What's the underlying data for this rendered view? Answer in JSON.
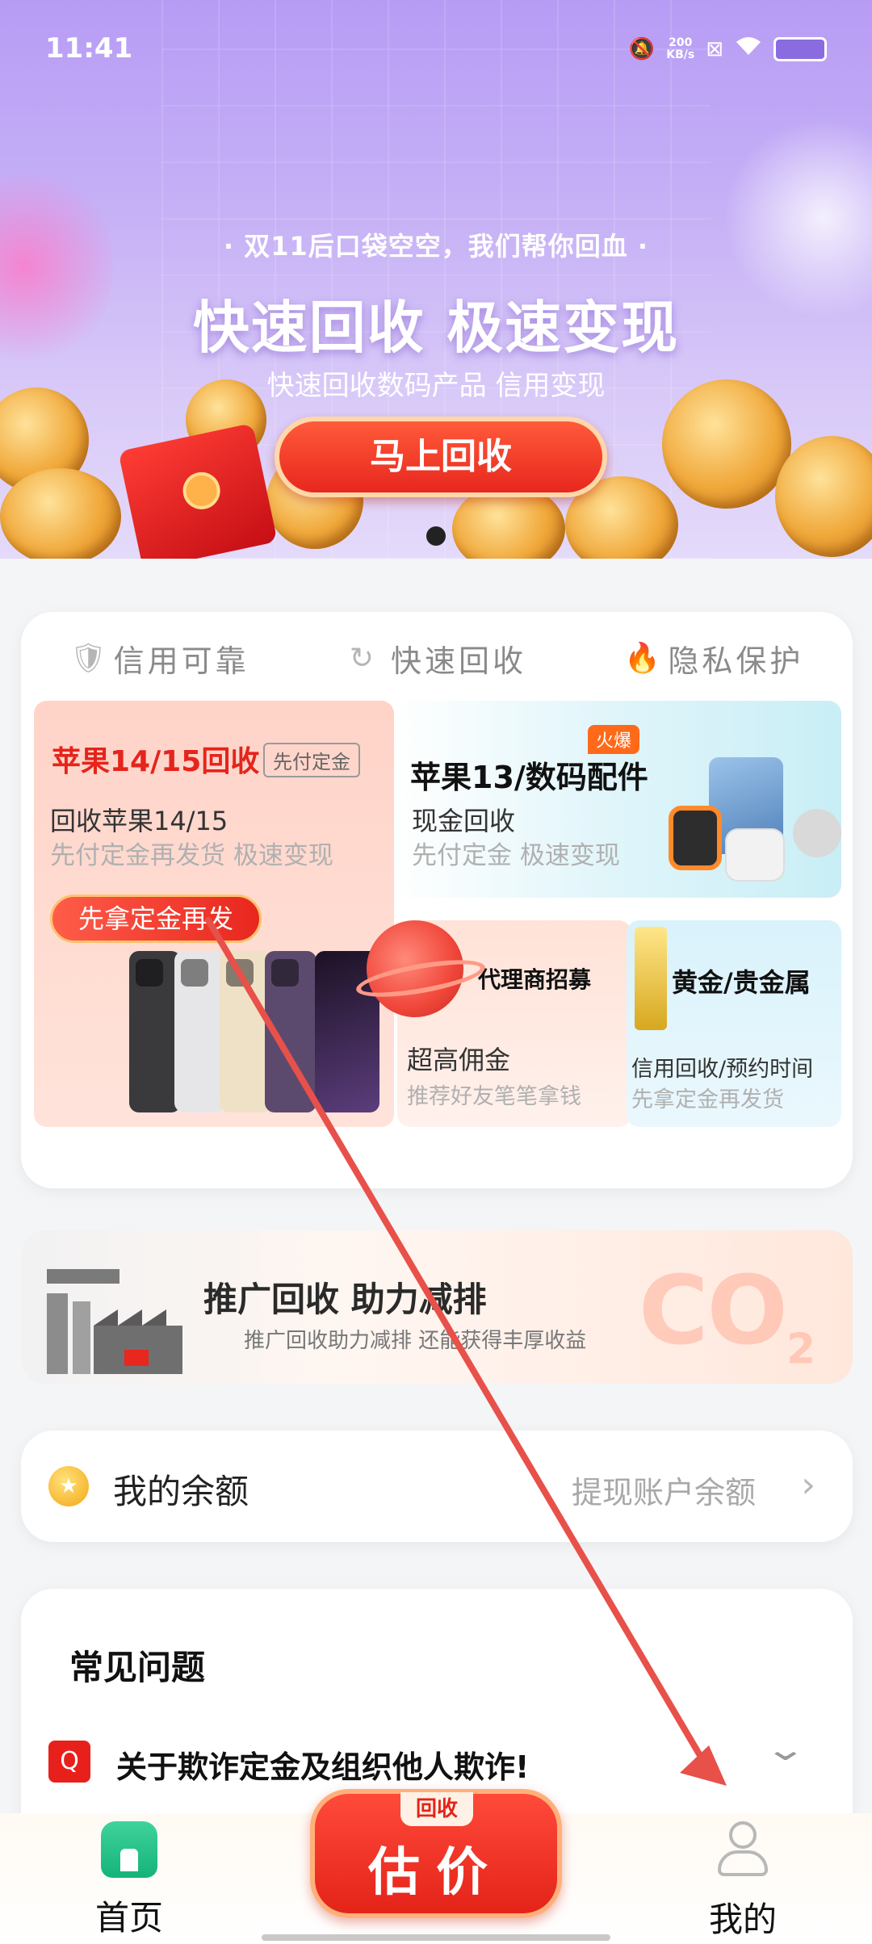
{
  "status_bar": {
    "time": "11:41",
    "net_speed_value": "200",
    "net_speed_unit": "KB/s"
  },
  "banner": {
    "subtitle": "· 双11后口袋空空，我们帮你回血 ·",
    "title": "快速回收 极速变现",
    "description": "快速回收数码产品 信用变现",
    "button": "马上回收",
    "page_indicator": {
      "current": 1,
      "total": 1
    }
  },
  "features": {
    "badges": [
      {
        "label": "信用可靠",
        "icon": "shield-check-icon"
      },
      {
        "label": "快速回收",
        "icon": "refresh-icon"
      },
      {
        "label": "隐私保护",
        "icon": "flame-icon"
      }
    ],
    "apple1415": {
      "title": "苹果14/15回收",
      "tag": "先付定金",
      "line1": "回收苹果14/15",
      "line2": "先付定金再发货 极速变现",
      "pill": "先拿定金再发"
    },
    "apple13": {
      "title": "苹果13/数码配件",
      "hot": "火爆",
      "line1": "现金回收",
      "line2": "先付定金 极速变现"
    },
    "agent": {
      "title": "代理商招募",
      "line1": "超高佣金",
      "line2": "推荐好友笔笔拿钱"
    },
    "gold": {
      "title": "黄金/贵金属",
      "line1": "信用回收/预约时间",
      "line2": "先拿定金再发货"
    }
  },
  "eco": {
    "title": "推广回收 助力减排",
    "subtitle": "推广回收助力减排 还能获得丰厚收益",
    "co2": "CO",
    "co2_sub": "2"
  },
  "balance": {
    "label": "我的余额",
    "link": "提现账户余额",
    "chevron": "›",
    "coin_glyph": "★"
  },
  "faq": {
    "title": "常见问题",
    "items": [
      {
        "mark": "Q",
        "question": "关于欺诈定金及组织他人欺诈!"
      }
    ]
  },
  "bottom_nav": {
    "home": "首页",
    "estimate_top": "回收",
    "estimate_main": "估价",
    "me": "我的"
  },
  "colors": {
    "accent_red": "#e8271e",
    "banner_purple": "#b79cf5",
    "home_green": "#14b37b",
    "annotation_arrow": "#e8504a"
  }
}
